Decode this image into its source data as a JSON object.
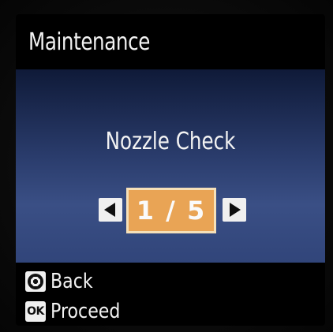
{
  "header": {
    "title": "Maintenance"
  },
  "menu": {
    "current_item": "Nozzle Check",
    "page_indicator": "1 / 5",
    "page_current": 1,
    "page_total": 5
  },
  "footer": {
    "back_label": "Back",
    "proceed_label": "Proceed",
    "ok_key_label": "OK"
  },
  "icons": {
    "left": "arrow-left-icon",
    "right": "arrow-right-icon",
    "stop": "stop-icon",
    "ok": "ok-key-icon"
  },
  "colors": {
    "panel_gradient_top": "#0f1a38",
    "panel_gradient_bottom": "#3a4f85",
    "selector_fill": "#e9a455",
    "selector_border": "#f6e0b8",
    "text": "#f2f2f2"
  }
}
